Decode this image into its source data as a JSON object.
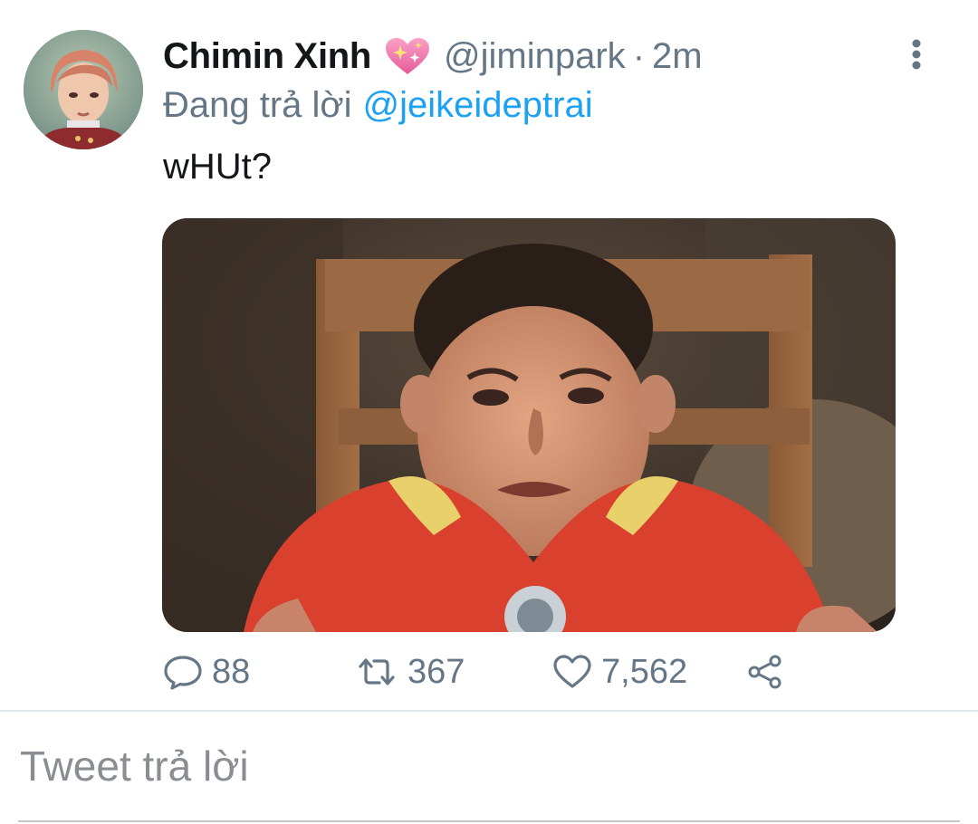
{
  "tweet": {
    "author": {
      "display_name": "Chimin Xinh",
      "handle": "@jiminpark",
      "emoji": "sparkling-heart-icon"
    },
    "separator": "·",
    "time": "2m",
    "reply_prefix": "Đang trả lời",
    "reply_to": "@jeikeideptrai",
    "text": "wHUt?",
    "stats": {
      "replies": "88",
      "retweets": "367",
      "likes": "7,562"
    }
  },
  "composer": {
    "placeholder": "Tweet trả lời"
  },
  "colors": {
    "text": "#14171a",
    "secondary": "#657786",
    "link": "#1da1f2",
    "divider": "#e1e8ed"
  },
  "icons": [
    "more-vertical-icon",
    "reply-icon",
    "retweet-icon",
    "like-icon",
    "share-icon"
  ]
}
